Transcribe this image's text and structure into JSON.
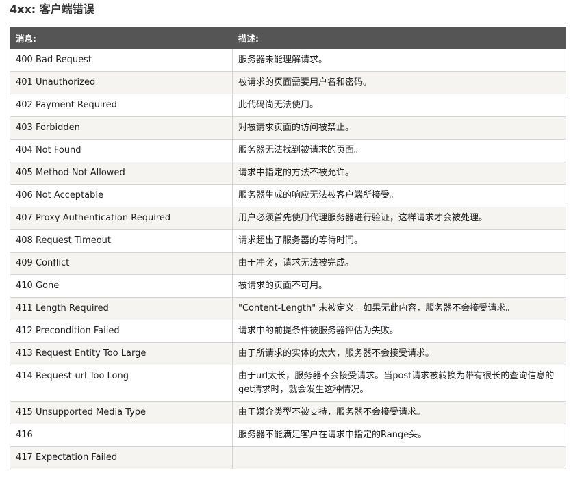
{
  "title": "4xx: 客户端错误",
  "table": {
    "headers": [
      "消息:",
      "描述:"
    ],
    "rows": [
      {
        "message": "400 Bad Request",
        "description": "服务器未能理解请求。"
      },
      {
        "message": "401 Unauthorized",
        "description": "被请求的页面需要用户名和密码。"
      },
      {
        "message": "402 Payment Required",
        "description": "此代码尚无法使用。"
      },
      {
        "message": "403 Forbidden",
        "description": "对被请求页面的访问被禁止。"
      },
      {
        "message": "404 Not Found",
        "description": "服务器无法找到被请求的页面。"
      },
      {
        "message": "405 Method Not Allowed",
        "description": "请求中指定的方法不被允许。"
      },
      {
        "message": "406 Not Acceptable",
        "description": "服务器生成的响应无法被客户端所接受。"
      },
      {
        "message": "407 Proxy Authentication Required",
        "description": "用户必须首先使用代理服务器进行验证，这样请求才会被处理。"
      },
      {
        "message": "408 Request Timeout",
        "description": "请求超出了服务器的等待时间。"
      },
      {
        "message": "409 Conflict",
        "description": "由于冲突，请求无法被完成。"
      },
      {
        "message": "410 Gone",
        "description": "被请求的页面不可用。"
      },
      {
        "message": "411 Length Required",
        "description": "\"Content-Length\" 未被定义。如果无此内容，服务器不会接受请求。"
      },
      {
        "message": "412 Precondition Failed",
        "description": "请求中的前提条件被服务器评估为失败。"
      },
      {
        "message": "413 Request Entity Too Large",
        "description": "由于所请求的实体的太大，服务器不会接受请求。"
      },
      {
        "message": "414 Request-url Too Long",
        "description": "由于url太长，服务器不会接受请求。当post请求被转换为带有很长的查询信息的get请求时，就会发生这种情况。"
      },
      {
        "message": "415 Unsupported Media Type",
        "description": "由于媒介类型不被支持，服务器不会接受请求。"
      },
      {
        "message": "416",
        "description": "服务器不能满足客户在请求中指定的Range头。"
      },
      {
        "message": "417 Expectation Failed",
        "description": ""
      }
    ]
  }
}
